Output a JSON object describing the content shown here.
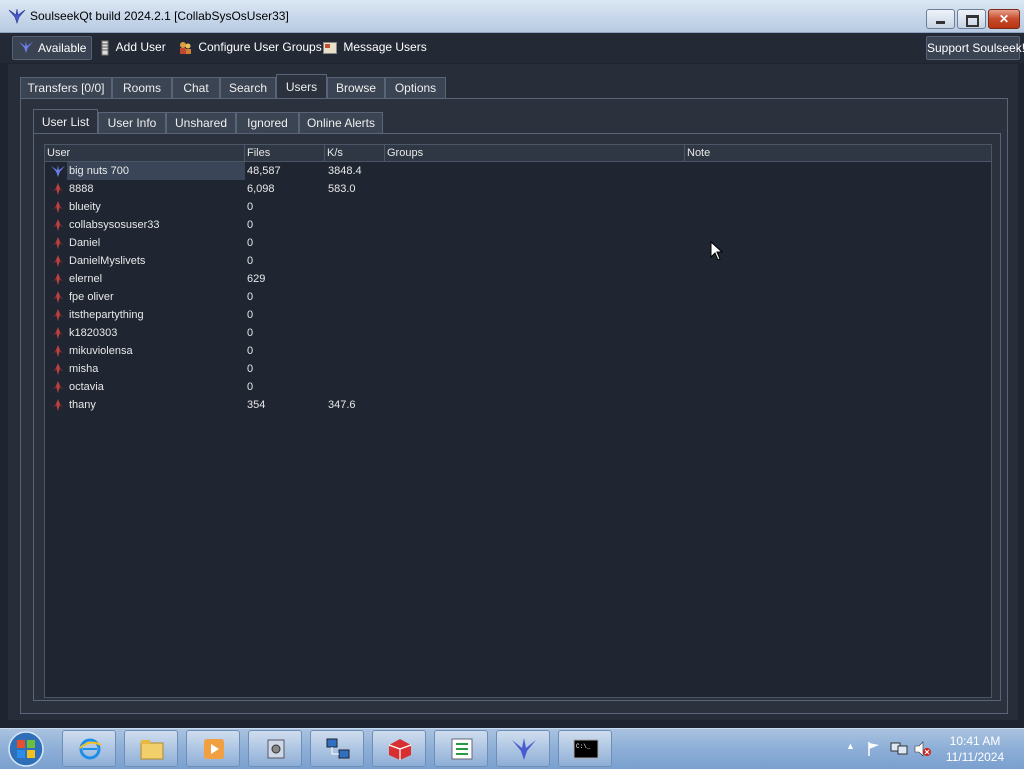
{
  "window": {
    "title": "SoulseekQt build 2024.2.1 [CollabSysOsUser33]"
  },
  "toolbar": {
    "status_label": "Available",
    "add_user": "Add User",
    "configure_groups": "Configure User Groups",
    "message_users": "Message Users",
    "support": "Support Soulseek!"
  },
  "main_tabs": [
    "Transfers [0/0]",
    "Rooms",
    "Chat",
    "Search",
    "Users",
    "Browse",
    "Options"
  ],
  "active_main_tab": "Users",
  "sub_tabs": [
    "User List",
    "User Info",
    "Unshared",
    "Ignored",
    "Online Alerts"
  ],
  "active_sub_tab": "User List",
  "columns": [
    "User",
    "Files",
    "K/s",
    "Groups",
    "Note"
  ],
  "users": [
    {
      "name": "big nuts 700",
      "files": "48,587",
      "speed": "3848.4",
      "icon": "soulseek-bird-icon",
      "selected": true
    },
    {
      "name": "8888",
      "files": "6,098",
      "speed": "583.0",
      "icon": "offline-user-icon"
    },
    {
      "name": "blueity",
      "files": "0",
      "speed": "",
      "icon": "offline-user-icon"
    },
    {
      "name": "collabsysosuser33",
      "files": "0",
      "speed": "",
      "icon": "offline-user-icon"
    },
    {
      "name": "Daniel",
      "files": "0",
      "speed": "",
      "icon": "offline-user-icon"
    },
    {
      "name": "DanielMyslivets",
      "files": "0",
      "speed": "",
      "icon": "offline-user-icon"
    },
    {
      "name": "elernel",
      "files": "629",
      "speed": "",
      "icon": "offline-user-icon"
    },
    {
      "name": "fpe oliver",
      "files": "0",
      "speed": "",
      "icon": "offline-user-icon"
    },
    {
      "name": "itsthepartything",
      "files": "0",
      "speed": "",
      "icon": "offline-user-icon"
    },
    {
      "name": "k1820303",
      "files": "0",
      "speed": "",
      "icon": "offline-user-icon"
    },
    {
      "name": "mikuviolensa",
      "files": "0",
      "speed": "",
      "icon": "offline-user-icon"
    },
    {
      "name": "misha",
      "files": "0",
      "speed": "",
      "icon": "offline-user-icon"
    },
    {
      "name": "octavia",
      "files": "0",
      "speed": "",
      "icon": "offline-user-icon"
    },
    {
      "name": "thany",
      "files": "354",
      "speed": "347.6",
      "icon": "offline-user-icon"
    }
  ],
  "taskbar": {
    "apps": [
      "internet-explorer-icon",
      "file-explorer-icon",
      "media-player-icon",
      "network-gear-icon",
      "network-computers-icon",
      "red-cube-icon",
      "task-list-icon",
      "soulseek-bird-icon",
      "command-prompt-icon"
    ],
    "clock_time": "10:41 AM",
    "clock_date": "11/11/2024"
  },
  "colors": {
    "accent_blue": "#5a6fd6",
    "offline_icon": "#c04040"
  }
}
